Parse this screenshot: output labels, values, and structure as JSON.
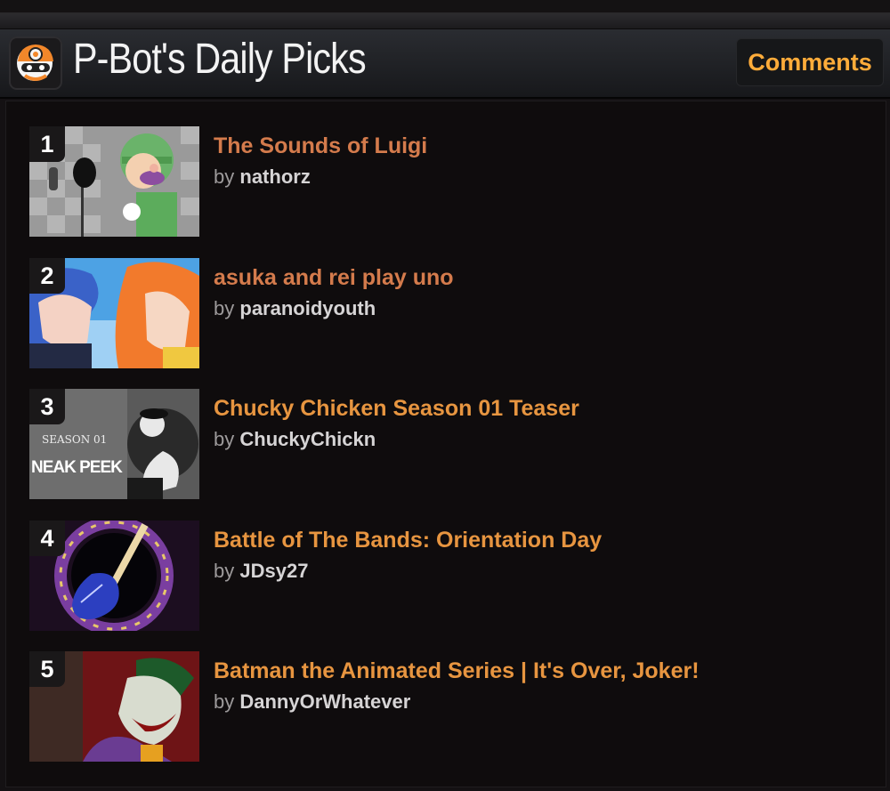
{
  "header": {
    "title": "P-Bot's Daily Picks",
    "comments_label": "Comments"
  },
  "picks": [
    {
      "rank": "1",
      "title": "The Sounds of Luigi",
      "by": "by",
      "author": "nathorz"
    },
    {
      "rank": "2",
      "title": "asuka and rei play uno",
      "by": "by",
      "author": "paranoidyouth"
    },
    {
      "rank": "3",
      "title": "Chucky Chicken Season 01 Teaser",
      "by": "by",
      "author": "ChuckyChickn",
      "thumb_text_1": "SEASON 01",
      "thumb_text_2": "NEAK PEEK"
    },
    {
      "rank": "4",
      "title": "Battle of The Bands: Orientation Day",
      "by": "by",
      "author": "JDsy27"
    },
    {
      "rank": "5",
      "title": "Batman the Animated Series | It's Over, Joker!",
      "by": "by",
      "author": "DannyOrWhatever"
    }
  ],
  "colors": {
    "accent": "#ffac3a",
    "title_orange": "#e79540",
    "title_rust": "#d47b4c"
  }
}
